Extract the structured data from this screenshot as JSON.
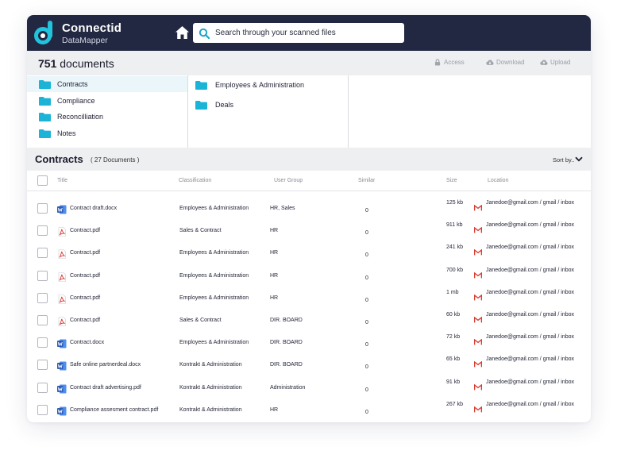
{
  "header": {
    "brand": "Connectid",
    "brand_sub": "DataMapper",
    "search_placeholder": "Search through your scanned files"
  },
  "docs_bar": {
    "count": "751",
    "count_label": "documents",
    "access": "Access",
    "download": "Download",
    "upload": "Upload"
  },
  "folders": {
    "left": [
      {
        "label": "Contracts",
        "active": true
      },
      {
        "label": "Compliance",
        "active": false
      },
      {
        "label": "Reconcilliation",
        "active": false
      },
      {
        "label": "Notes",
        "active": false
      }
    ],
    "middle": [
      {
        "label": "Employees & Administration"
      },
      {
        "label": "Deals"
      }
    ]
  },
  "section": {
    "title": "Contracts",
    "count": "( 27 Documents )",
    "sort": "Sort by.."
  },
  "table": {
    "headers": {
      "title": "Title",
      "classification": "Classification",
      "user_group": "User Group",
      "similar": "Similar",
      "size": "Size",
      "location": "Location"
    },
    "rows": [
      {
        "type": "word",
        "title": "Contract draft.docx",
        "classification": "Employees & Administration",
        "group": "HR, Sales",
        "similar": "0",
        "size": "125 kb",
        "location": "Janedoe@gmail.com / gmail / inbox"
      },
      {
        "type": "pdf",
        "title": "Contract.pdf",
        "classification": "Sales & Contract",
        "group": "HR",
        "similar": "0",
        "size": "911 kb",
        "location": "Janedoe@gmail.com / gmail / inbox"
      },
      {
        "type": "pdf",
        "title": "Contract.pdf",
        "classification": "Employees & Administration",
        "group": "HR",
        "similar": "0",
        "size": "241 kb",
        "location": "Janedoe@gmail.com / gmail / inbox"
      },
      {
        "type": "pdf",
        "title": "Contract.pdf",
        "classification": "Employees & Administration",
        "group": "HR",
        "similar": "0",
        "size": "700 kb",
        "location": "Janedoe@gmail.com / gmail / inbox"
      },
      {
        "type": "pdf",
        "title": "Contract.pdf",
        "classification": "Employees & Administration",
        "group": "HR",
        "similar": "0",
        "size": "1 mb",
        "location": "Janedoe@gmail.com / gmail / inbox"
      },
      {
        "type": "pdf",
        "title": "Contract.pdf",
        "classification": "Sales & Contract",
        "group": "DIR. BOARD",
        "similar": "0",
        "size": "60 kb",
        "location": "Janedoe@gmail.com / gmail / inbox"
      },
      {
        "type": "word",
        "title": "Contract.docx",
        "classification": "Employees & Administration",
        "group": "DIR. BOARD",
        "similar": "0",
        "size": "72 kb",
        "location": "Janedoe@gmail.com / gmail / inbox"
      },
      {
        "type": "word",
        "title": "Safe online partnerdeal.docx",
        "classification": "Kontrakt & Administration",
        "group": "DIR. BOARD",
        "similar": "0",
        "size": "65 kb",
        "location": "Janedoe@gmail.com / gmail / inbox"
      },
      {
        "type": "word",
        "title": "Contract draft advertising.pdf",
        "classification": "Kontrakt & Administration",
        "group": "Administration",
        "similar": "0",
        "size": "91 kb",
        "location": "Janedoe@gmail.com / gmail / inbox"
      },
      {
        "type": "word",
        "title": "Compliance assesment contract.pdf",
        "classification": "Kontrakt & Administration",
        "group": "HR",
        "similar": "0",
        "size": "267 kb",
        "location": "Janedoe@gmail.com / gmail / inbox"
      }
    ]
  },
  "colors": {
    "header_bg": "#232842",
    "accent_cyan": "#22c3dd",
    "folder": "#1bb3d6",
    "word_blue": "#2b5cb8",
    "pdf_red": "#d9322e",
    "gmail_red": "#d93b30"
  }
}
